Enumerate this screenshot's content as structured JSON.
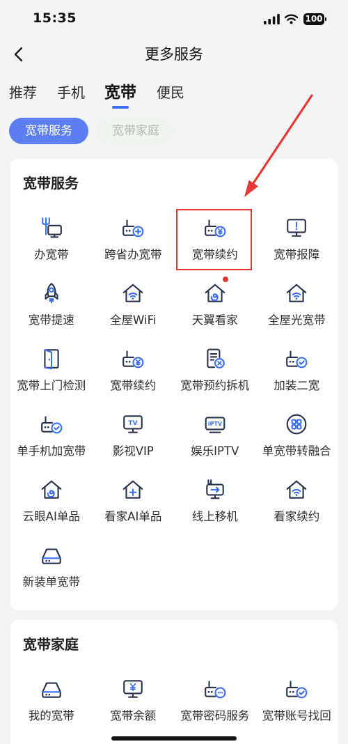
{
  "status_bar": {
    "time": "15:35",
    "battery": "100"
  },
  "header": {
    "title": "更多服务"
  },
  "tabs": [
    {
      "label": "推荐",
      "active": false
    },
    {
      "label": "手机",
      "active": false
    },
    {
      "label": "宽带",
      "active": true
    },
    {
      "label": "便民",
      "active": false
    }
  ],
  "filters": [
    {
      "label": "宽带服务",
      "active": true
    },
    {
      "label": "宽带家庭",
      "active": false
    }
  ],
  "sections": [
    {
      "title": "宽带服务",
      "items": [
        {
          "label": "办宽带",
          "icon": "broadband-monitor-icon"
        },
        {
          "label": "跨省办宽带",
          "icon": "router-plus-icon"
        },
        {
          "label": "宽带续约",
          "icon": "router-yen-icon",
          "highlighted": true
        },
        {
          "label": "宽带报障",
          "icon": "monitor-alert-icon"
        },
        {
          "label": "宽带提速",
          "icon": "rocket-icon"
        },
        {
          "label": "全屋WiFi",
          "icon": "house-wifi-icon"
        },
        {
          "label": "天翼看家",
          "icon": "house-camera-icon",
          "badge_dot": true
        },
        {
          "label": "全屋光宽带",
          "icon": "house-wifi-icon"
        },
        {
          "label": "宽带上门检测",
          "icon": "door-icon"
        },
        {
          "label": "宽带续约",
          "icon": "router-yen-icon"
        },
        {
          "label": "宽带预约拆机",
          "icon": "document-cancel-icon"
        },
        {
          "label": "加装二宽",
          "icon": "router-check-icon"
        },
        {
          "label": "单手机加宽带",
          "icon": "router-check-icon"
        },
        {
          "label": "影视VIP",
          "icon": "tv-icon",
          "icon_text": "TV"
        },
        {
          "label": "娱乐IPTV",
          "icon": "iptv-icon",
          "icon_text": "iPTV"
        },
        {
          "label": "单宽带转融合",
          "icon": "apps-circle-icon"
        },
        {
          "label": "云眼AI单品",
          "icon": "house-camera-icon"
        },
        {
          "label": "看家AI单品",
          "icon": "house-plus-icon"
        },
        {
          "label": "线上移机",
          "icon": "monitor-move-icon"
        },
        {
          "label": "看家续约",
          "icon": "house-wifi-icon"
        },
        {
          "label": "新装单宽带",
          "icon": "modem-icon"
        }
      ]
    },
    {
      "title": "宽带家庭",
      "items": [
        {
          "label": "我的宽带",
          "icon": "modem-icon"
        },
        {
          "label": "宽带余额",
          "icon": "monitor-yen-icon"
        },
        {
          "label": "宽带密码服务",
          "icon": "router-password-icon"
        },
        {
          "label": "宽带账号找回",
          "icon": "router-check-icon"
        }
      ]
    }
  ],
  "colors": {
    "accent": "#3b6ef2",
    "pill_active": "#5b7ef3",
    "pill_inactive_bg": "#eef4ec",
    "annotation": "#e53935",
    "icon_line": "#28344e",
    "page_bg": "#f3f4f6"
  }
}
